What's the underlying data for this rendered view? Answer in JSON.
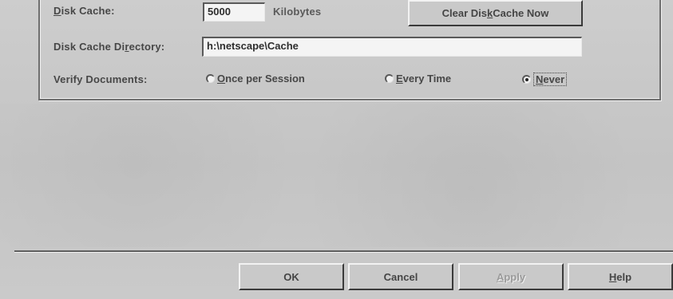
{
  "cache": {
    "disk_cache_label_first": "D",
    "disk_cache_label_rest": "isk Cache:",
    "disk_cache_value": "5000",
    "kilobytes_label": "Kilobytes",
    "clear_button_pre": "Clear Dis",
    "clear_button_accel": "k",
    "clear_button_post": " Cache Now",
    "directory_label_pre": "Disk Cache Di",
    "directory_label_accel": "r",
    "directory_label_post": "ectory:",
    "directory_value": "h:\\netscape\\Cache",
    "verify_label": "Verify Documents:",
    "verify_options": [
      {
        "accel": "O",
        "rest": "nce per Session",
        "checked": false
      },
      {
        "accel": "E",
        "rest": "very Time",
        "checked": false
      },
      {
        "accel": "N",
        "rest": "ever",
        "checked": true
      }
    ]
  },
  "buttons": {
    "ok": "OK",
    "cancel": "Cancel",
    "apply_accel": "A",
    "apply_rest": "pply",
    "help_accel": "H",
    "help_rest": "elp"
  }
}
